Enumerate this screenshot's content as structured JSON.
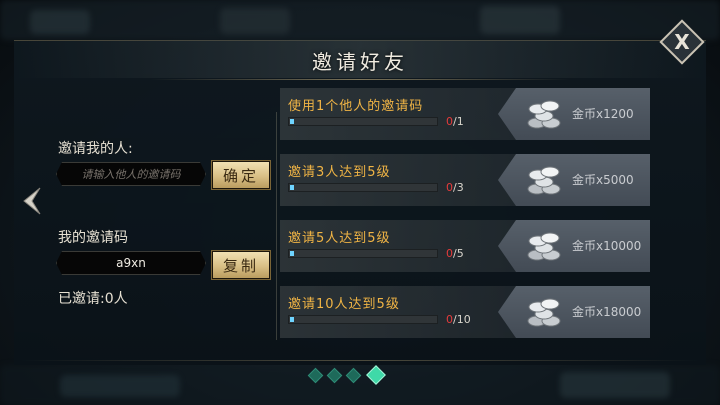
{
  "header": {
    "title": "邀请好友",
    "close_label": "X"
  },
  "left": {
    "inviter_label": "邀请我的人:",
    "inviter_input": {
      "value": "",
      "placeholder": "请输入他人的邀请码"
    },
    "confirm_label": "确定",
    "my_code_label": "我的邀请码",
    "my_code_value": "a9xn",
    "copy_label": "复制",
    "invited_text": "已邀请:0人"
  },
  "tasks": [
    {
      "name": "使用1个他人的邀请码",
      "current": "0",
      "total": "/1",
      "progress": 0,
      "reward": "金币x1200"
    },
    {
      "name": "邀请3人达到5级",
      "current": "0",
      "total": "/3",
      "progress": 0,
      "reward": "金币x5000"
    },
    {
      "name": "邀请5人达到5级",
      "current": "0",
      "total": "/5",
      "progress": 0,
      "reward": "金币x10000"
    },
    {
      "name": "邀请10人达到5级",
      "current": "0",
      "total": "/10",
      "progress": 0,
      "reward": "金币x18000"
    }
  ],
  "pagination": {
    "pages": 4,
    "active_page": 4
  },
  "colors": {
    "task_name": "#f0b445",
    "progress_fill": "#6fd4ff",
    "count_current": "#e53b3b",
    "button_gold": "#d8bf85",
    "active_dot": "#3fd9a8"
  },
  "icons": {
    "close": "close-icon",
    "prev": "chevron-left-icon",
    "reward": "silver-coins-icon"
  }
}
